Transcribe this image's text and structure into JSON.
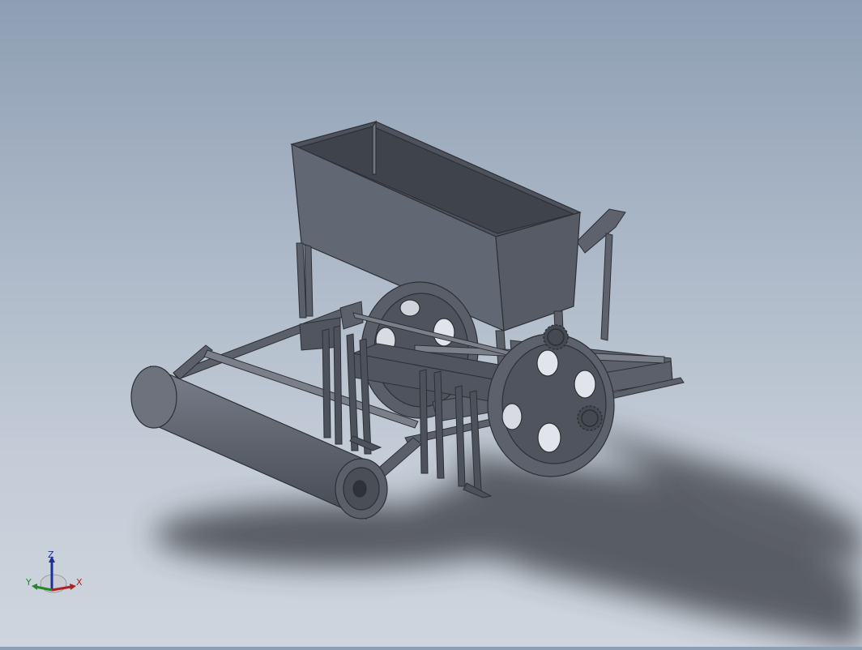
{
  "viewport": {
    "background_top": "#8e9fb3",
    "background_bottom": "#ced5de",
    "model_color": "#5f6470"
  },
  "triad": {
    "z_label": "Z",
    "y_label": "Y",
    "x_label": "X",
    "colors": {
      "z": "#1d2f9a",
      "y": "#1f8a2a",
      "x": "#b02020"
    }
  }
}
